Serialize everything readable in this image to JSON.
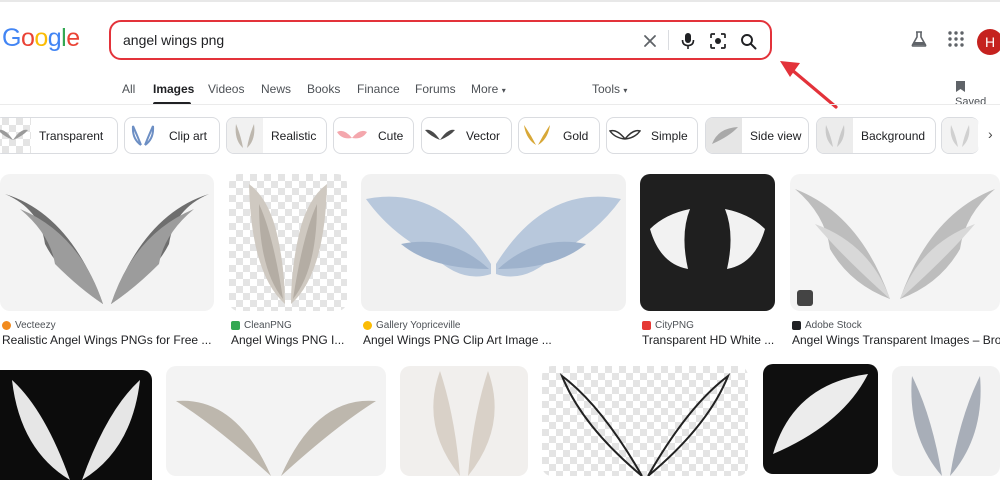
{
  "header": {
    "logo_letters": [
      {
        "ch": "G",
        "color": "#4285F4"
      },
      {
        "ch": "o",
        "color": "#EA4335"
      },
      {
        "ch": "o",
        "color": "#FBBC05"
      },
      {
        "ch": "g",
        "color": "#4285F4"
      },
      {
        "ch": "l",
        "color": "#34A853"
      },
      {
        "ch": "e",
        "color": "#EA4335"
      }
    ],
    "search_value": "angel wings png",
    "avatar_initial": "H",
    "saved_label": "Saved",
    "highlight_color": "#e3323a"
  },
  "tabs": [
    {
      "label": "All",
      "active": false
    },
    {
      "label": "Images",
      "active": true
    },
    {
      "label": "Videos",
      "active": false
    },
    {
      "label": "News",
      "active": false
    },
    {
      "label": "Books",
      "active": false
    },
    {
      "label": "Finance",
      "active": false
    },
    {
      "label": "Forums",
      "active": false
    },
    {
      "label": "More",
      "active": false
    }
  ],
  "tools_label": "Tools",
  "chips": [
    "Transparent",
    "Clip art",
    "Realistic",
    "Cute",
    "Vector",
    "Gold",
    "Simple",
    "Side view",
    "Background"
  ],
  "results_row1": [
    {
      "source": "Vecteezy",
      "source_color": "#f28b1e",
      "title": "Realistic Angel Wings PNGs for Free ..."
    },
    {
      "source": "CleanPNG",
      "source_color": "#34a853",
      "title": "Angel Wings PNG I..."
    },
    {
      "source": "Gallery Yopriceville",
      "source_color": "#fbbc05",
      "title": "Angel Wings PNG Clip Art Image ..."
    },
    {
      "source": "CityPNG",
      "source_color": "#e53935",
      "title": "Transparent HD White ..."
    },
    {
      "source": "Adobe Stock",
      "source_color": "#202124",
      "title": "Angel Wings Transparent Images – Bro..."
    }
  ]
}
